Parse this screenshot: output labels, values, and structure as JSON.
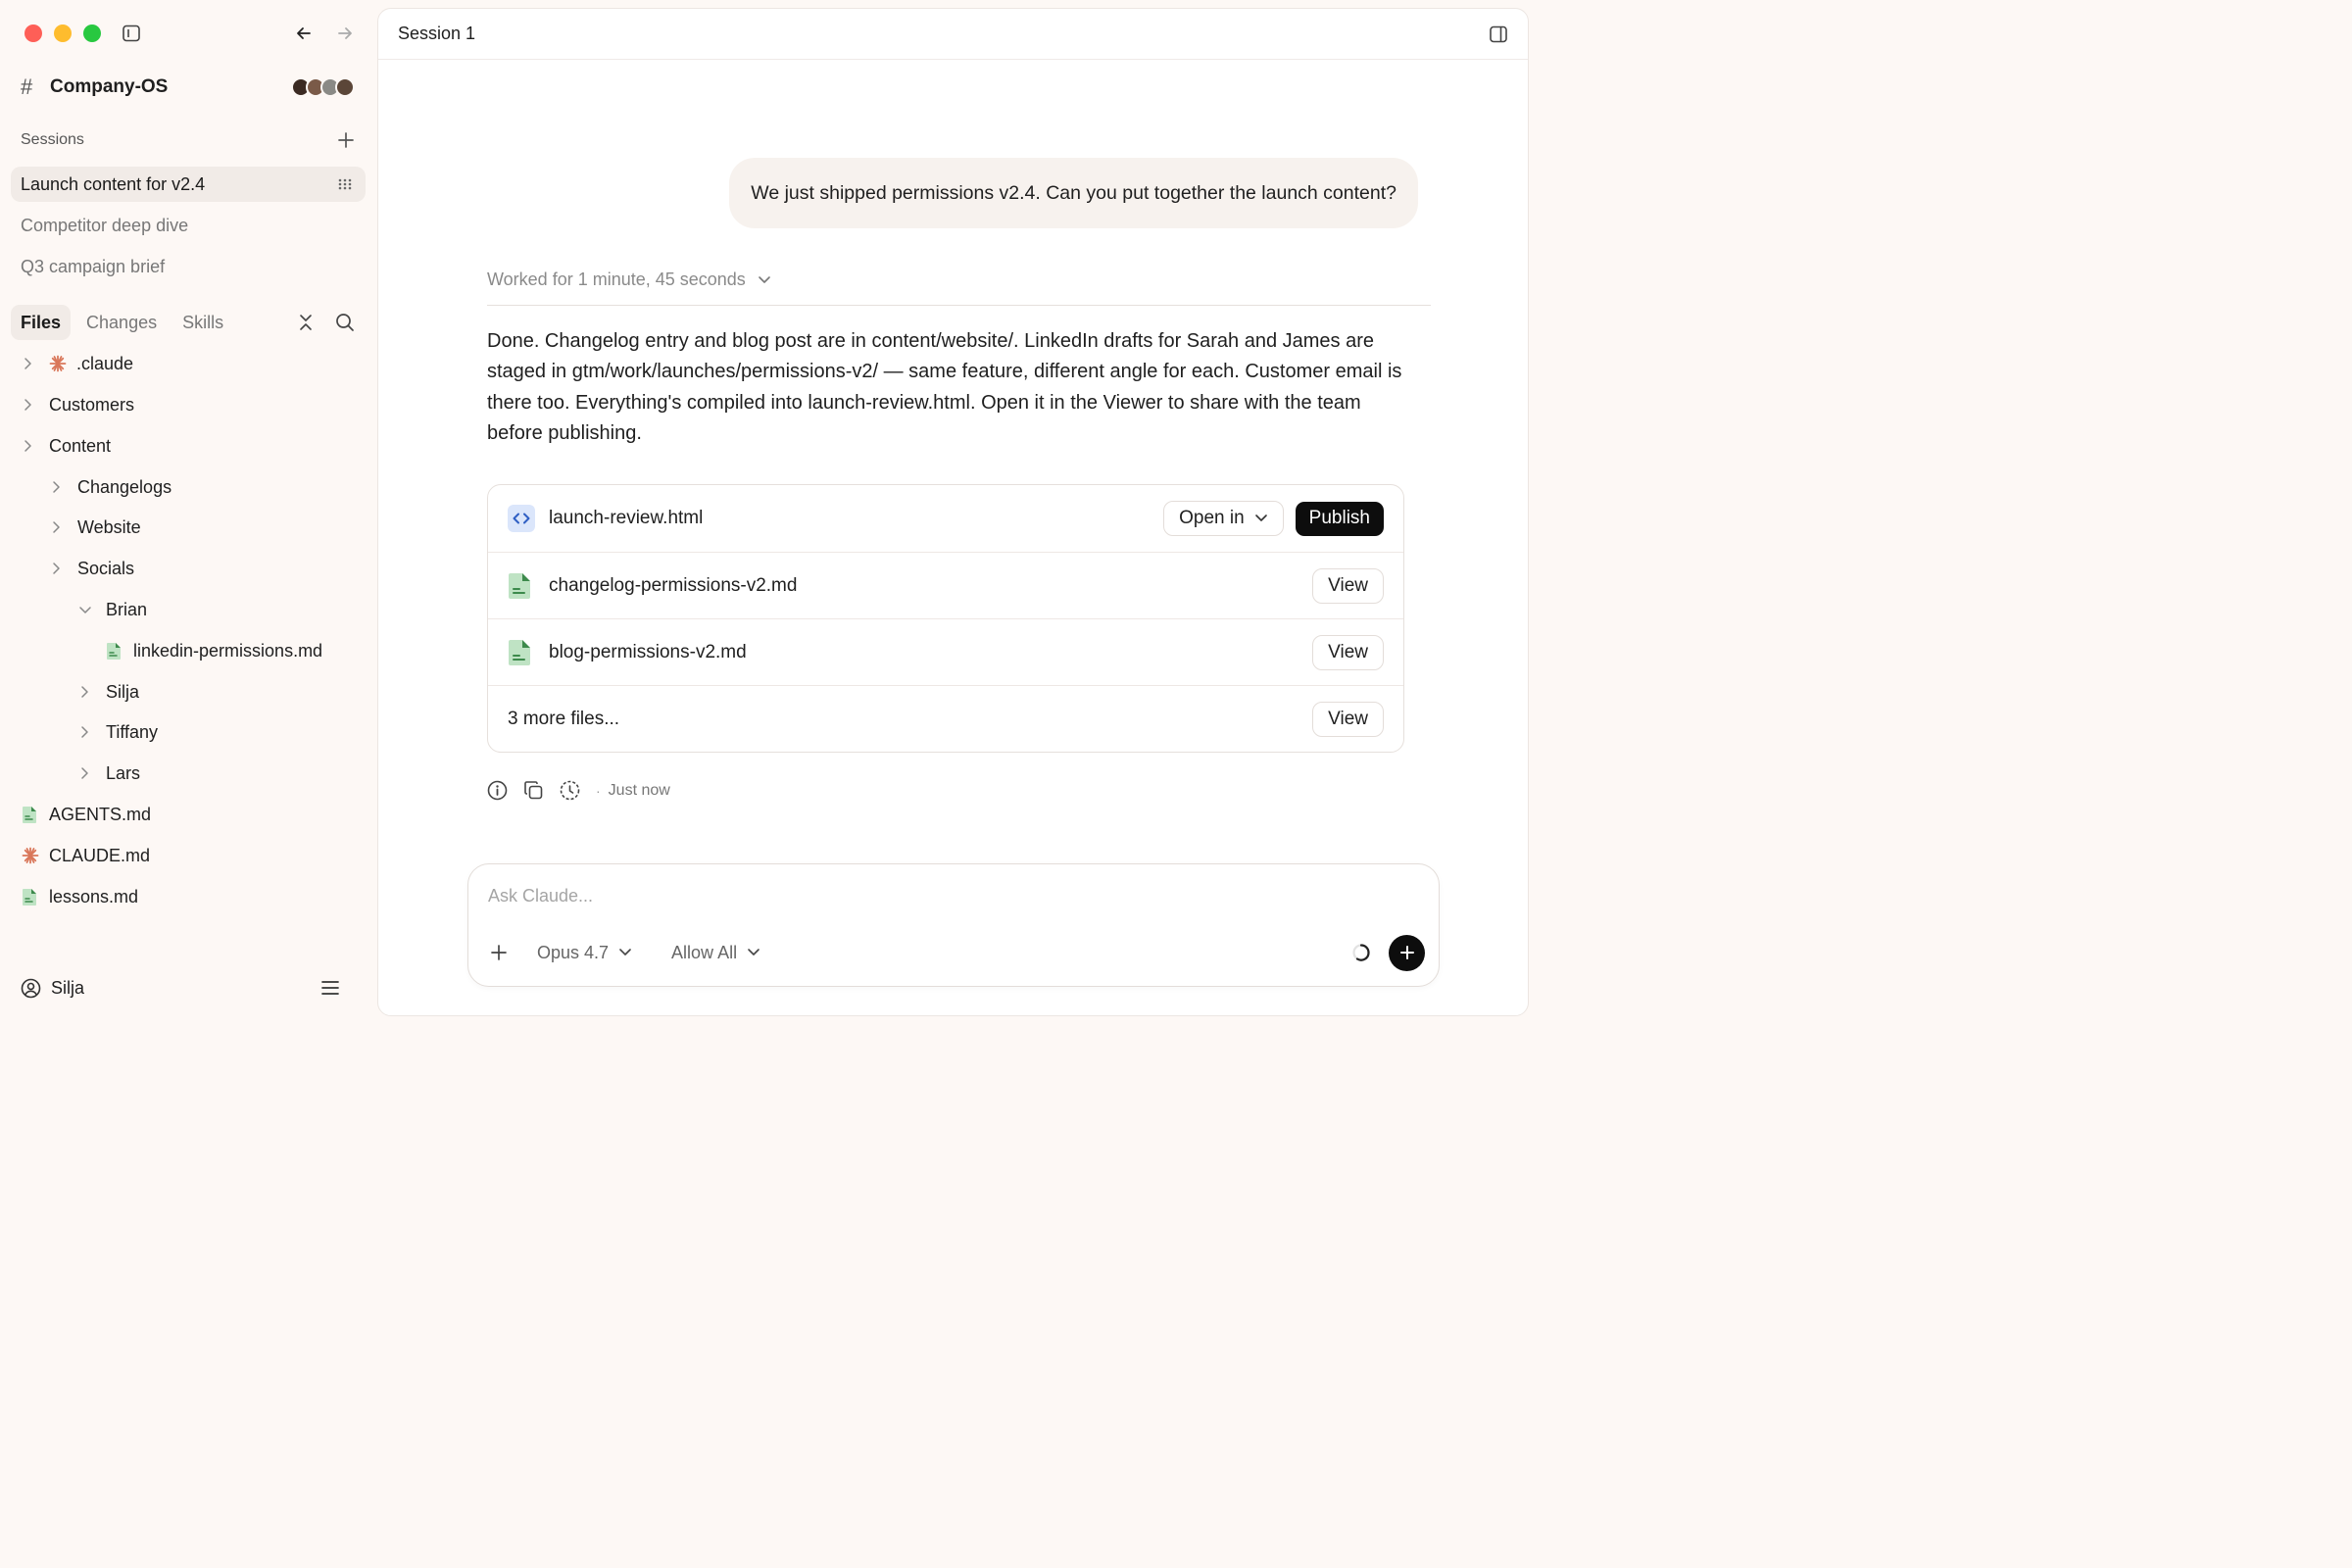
{
  "app": {
    "workspace_name": "Company-OS",
    "workspace_symbol": "#"
  },
  "sidebar": {
    "sessions_label": "Sessions",
    "sessions": [
      {
        "label": "Launch content for v2.4",
        "active": true
      },
      {
        "label": "Competitor deep dive",
        "active": false
      },
      {
        "label": "Q3 campaign brief",
        "active": false
      }
    ],
    "tabs": [
      {
        "label": "Files",
        "active": true
      },
      {
        "label": "Changes",
        "active": false
      },
      {
        "label": "Skills",
        "active": false
      }
    ],
    "tree": [
      {
        "label": ".claude",
        "depth": 0,
        "kind": "folder",
        "icon": "claude-asterisk-icon",
        "expanded": false
      },
      {
        "label": "Customers",
        "depth": 0,
        "kind": "folder",
        "expanded": false
      },
      {
        "label": "Content",
        "depth": 0,
        "kind": "folder",
        "expanded": false
      },
      {
        "label": "Changelogs",
        "depth": 1,
        "kind": "folder",
        "expanded": false
      },
      {
        "label": "Website",
        "depth": 1,
        "kind": "folder",
        "expanded": false
      },
      {
        "label": "Socials",
        "depth": 1,
        "kind": "folder",
        "expanded": false
      },
      {
        "label": "Brian",
        "depth": 2,
        "kind": "folder",
        "expanded": true
      },
      {
        "label": "linkedin-permissions.md",
        "depth": 3,
        "kind": "file",
        "icon": "markdown-file-icon"
      },
      {
        "label": "Silja",
        "depth": 2,
        "kind": "folder",
        "expanded": false
      },
      {
        "label": "Tiffany",
        "depth": 2,
        "kind": "folder",
        "expanded": false
      },
      {
        "label": "Lars",
        "depth": 2,
        "kind": "folder",
        "expanded": false
      },
      {
        "label": "AGENTS.md",
        "depth": 0,
        "kind": "file",
        "icon": "markdown-file-icon"
      },
      {
        "label": "CLAUDE.md",
        "depth": 0,
        "kind": "file",
        "icon": "claude-asterisk-icon"
      },
      {
        "label": "lessons.md",
        "depth": 0,
        "kind": "file",
        "icon": "markdown-file-icon"
      }
    ],
    "user_name": "Silja"
  },
  "main": {
    "session_title": "Session 1",
    "user_message": "We just shipped permissions v2.4. Can you put together the launch content?",
    "worked_for": "Worked for 1 minute, 45 seconds",
    "response": "Done. Changelog entry and blog post are in content/website/. LinkedIn drafts for Sarah and James are staged in gtm/work/launches/permissions-v2/ — same feature, different angle for each. Customer email is there too. Everything's compiled into launch-review.html. Open it in the Viewer to share with the team before publishing.",
    "files": {
      "primary": {
        "name": "launch-review.html",
        "open_in_label": "Open in",
        "publish_label": "Publish"
      },
      "items": [
        {
          "name": "changelog-permissions-v2.md",
          "view_label": "View"
        },
        {
          "name": "blog-permissions-v2.md",
          "view_label": "View"
        }
      ],
      "more": {
        "label": "3 more files...",
        "view_label": "View"
      }
    },
    "timestamp": "Just now",
    "composer": {
      "placeholder": "Ask Claude...",
      "model": "Opus 4.7",
      "permission": "Allow All"
    }
  },
  "colors": {
    "accent_dark": "#0d0d0d",
    "claude_orange": "#d9775a",
    "markdown_green": "#5fae6e",
    "html_blue": "#3b6fd8"
  }
}
